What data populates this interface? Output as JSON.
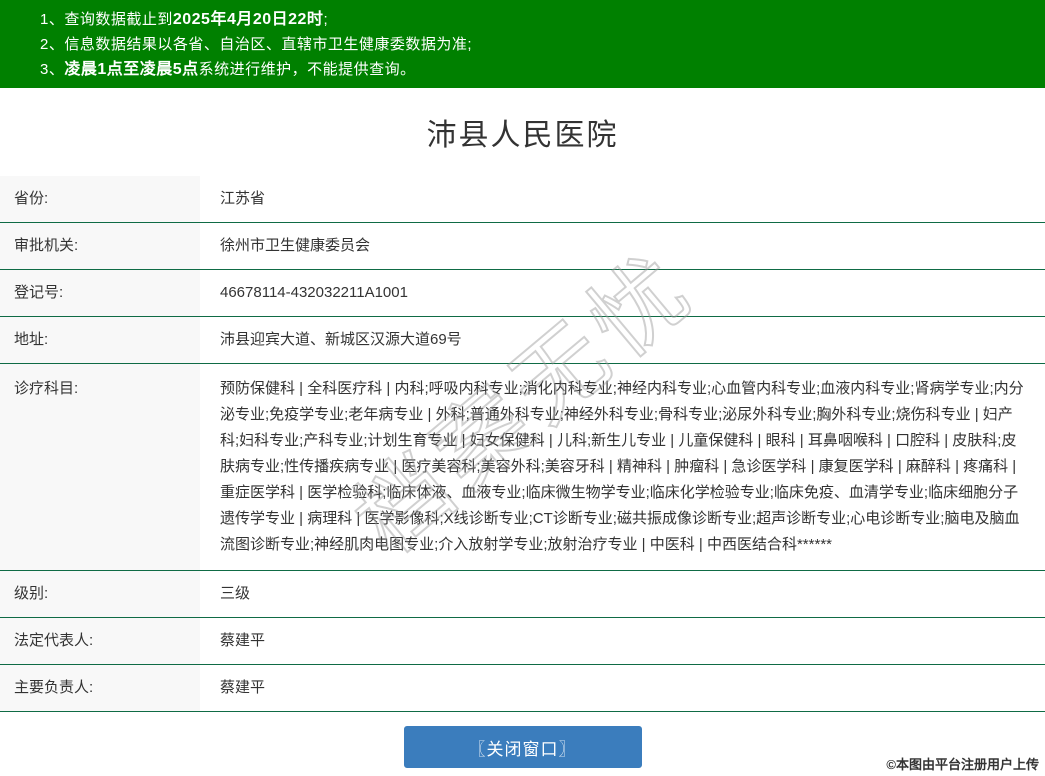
{
  "notices": [
    {
      "prefix": "1、查询数据截止到",
      "bold": "2025年4月20日22时",
      "suffix": ";"
    },
    {
      "prefix": "2、信息数据结果以各省、自治区、直辖市卫生健康委数据为准;",
      "bold": "",
      "suffix": ""
    },
    {
      "prefix": "3、",
      "bold": "凌晨1点至凌晨5点",
      "suffix": "系统进行维护，不能提供查询。"
    }
  ],
  "title": "沛县人民医院",
  "table": {
    "rows": [
      {
        "label": "省份:",
        "value": "江苏省"
      },
      {
        "label": "审批机关:",
        "value": "徐州市卫生健康委员会"
      },
      {
        "label": "登记号:",
        "value": "46678114-432032211A1001"
      },
      {
        "label": "地址:",
        "value": "沛县迎宾大道、新城区汉源大道69号"
      },
      {
        "label": "诊疗科目:",
        "value": "预防保健科 | 全科医疗科 | 内科;呼吸内科专业;消化内科专业;神经内科专业;心血管内科专业;血液内科专业;肾病学专业;内分泌专业;免疫学专业;老年病专业 | 外科;普通外科专业;神经外科专业;骨科专业;泌尿外科专业;胸外科专业;烧伤科专业 | 妇产科;妇科专业;产科专业;计划生育专业 | 妇女保健科 | 儿科;新生儿专业 | 儿童保健科 | 眼科 | 耳鼻咽喉科 | 口腔科 | 皮肤科;皮肤病专业;性传播疾病专业 | 医疗美容科;美容外科;美容牙科 | 精神科 | 肿瘤科 | 急诊医学科 | 康复医学科 | 麻醉科 | 疼痛科 | 重症医学科 | 医学检验科;临床体液、血液专业;临床微生物学专业;临床化学检验专业;临床免疫、血清学专业;临床细胞分子遗传学专业 | 病理科 | 医学影像科;X线诊断专业;CT诊断专业;磁共振成像诊断专业;超声诊断专业;心电诊断专业;脑电及脑血流图诊断专业;神经肌肉电图专业;介入放射学专业;放射治疗专业 | 中医科 | 中西医结合科******"
      },
      {
        "label": "级别:",
        "value": "三级"
      },
      {
        "label": "法定代表人:",
        "value": "蔡建平"
      },
      {
        "label": "主要负责人:",
        "value": "蔡建平"
      }
    ]
  },
  "close_button_label": "〖关闭窗口〗",
  "watermarks": {
    "diagonal_text": "档案无忧",
    "copyright": "©本图由平台注册用户上传"
  },
  "colors": {
    "banner_green": "#008000",
    "row_border_green": "#0f6b45",
    "label_bg": "#f8f8f8",
    "button_blue": "#3b7dbd"
  }
}
